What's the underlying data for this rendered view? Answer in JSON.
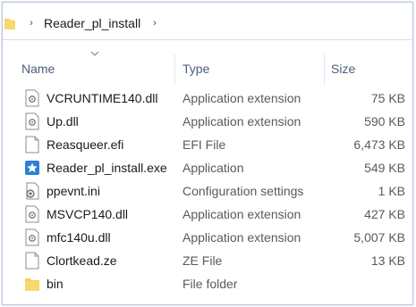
{
  "address_bar": {
    "path_segment": "Reader_pl_install",
    "separator_glyph": "›"
  },
  "columns": {
    "name": "Name",
    "type": "Type",
    "size": "Size"
  },
  "files": [
    {
      "name": "VCRUNTIME140.dll",
      "type": "Application extension",
      "size": "75 KB",
      "icon": "dll-file-icon"
    },
    {
      "name": "Up.dll",
      "type": "Application extension",
      "size": "590 KB",
      "icon": "dll-file-icon"
    },
    {
      "name": "Reasqueer.efi",
      "type": "EFI File",
      "size": "6,473 KB",
      "icon": "blank-file-icon"
    },
    {
      "name": "Reader_pl_install.exe",
      "type": "Application",
      "size": "549 KB",
      "icon": "application-star-icon"
    },
    {
      "name": "ppevnt.ini",
      "type": "Configuration settings",
      "size": "1 KB",
      "icon": "settings-file-icon"
    },
    {
      "name": "MSVCP140.dll",
      "type": "Application extension",
      "size": "427 KB",
      "icon": "dll-file-icon"
    },
    {
      "name": "mfc140u.dll",
      "type": "Application extension",
      "size": "5,007 KB",
      "icon": "dll-file-icon"
    },
    {
      "name": "Clortkead.ze",
      "type": "ZE File",
      "size": "13 KB",
      "icon": "blank-file-icon"
    },
    {
      "name": "bin",
      "type": "File folder",
      "size": "",
      "icon": "folder-icon"
    }
  ],
  "colors": {
    "folder": "#f7cf5b",
    "header_text": "#4c607a",
    "app_icon": "#2f7fd6"
  }
}
